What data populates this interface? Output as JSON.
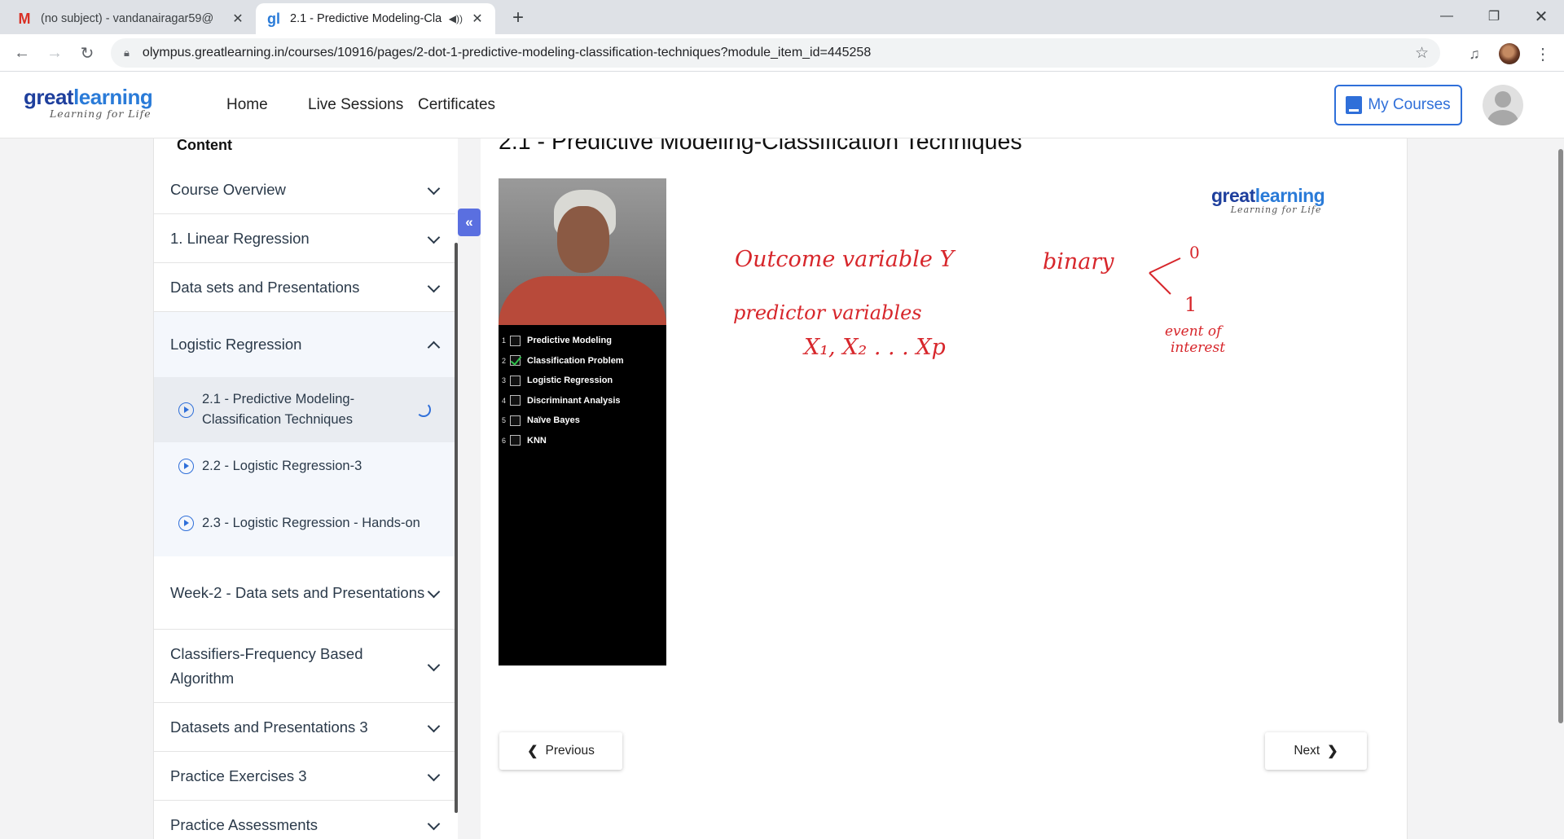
{
  "browser": {
    "tabs": [
      {
        "title": "(no subject) - vandanairagar59@",
        "favicon": "M",
        "favicon_color": "#d93025"
      },
      {
        "title": "2.1 - Predictive Modeling-Cla",
        "favicon": "gl",
        "favicon_color": "#2a7bd8"
      }
    ],
    "new_tab": "+",
    "window": {
      "minimize": "—",
      "restore": "❐",
      "close": "✕"
    },
    "url": "olympus.greatlearning.in/courses/10916/pages/2-dot-1-predictive-modeling-classification-techniques?module_item_id=445258"
  },
  "header": {
    "logo_great": "great",
    "logo_learning": "learning",
    "logo_tagline": "Learning for Life",
    "nav": [
      "Home",
      "Live Sessions",
      "Certificates"
    ],
    "my_courses": "My Courses"
  },
  "sidebar": {
    "title": "Content",
    "collapse_icon": "«",
    "modules": [
      {
        "label": "Course Overview",
        "state": "collapsed"
      },
      {
        "label": "1. Linear Regression",
        "state": "collapsed"
      },
      {
        "label": "Data sets and Presentations",
        "state": "collapsed"
      },
      {
        "label": "Logistic Regression",
        "state": "expanded"
      },
      {
        "label": "Week-2 - Data sets and Presentations",
        "state": "collapsed"
      },
      {
        "label": "Classifiers-Frequency Based Algorithm",
        "state": "collapsed"
      },
      {
        "label": "Datasets and Presentations 3",
        "state": "collapsed"
      },
      {
        "label": "Practice Exercises 3",
        "state": "collapsed"
      },
      {
        "label": "Practice Assessments",
        "state": "collapsed"
      }
    ],
    "items": [
      {
        "label": "2.1 - Predictive Modeling-Classification Techniques",
        "current": true
      },
      {
        "label": "2.2 - Logistic Regression-3",
        "current": false
      },
      {
        "label": "2.3 - Logistic Regression - Hands-on",
        "current": false
      }
    ]
  },
  "main": {
    "title": "2.1 - Predictive Modeling-Classification Techniques",
    "video": {
      "toc": [
        {
          "num": "1",
          "label": "Predictive Modeling",
          "checked": false
        },
        {
          "num": "2",
          "label": "Classification Problem",
          "checked": true
        },
        {
          "num": "3",
          "label": "Logistic Regression",
          "checked": false
        },
        {
          "num": "4",
          "label": "Discriminant Analysis",
          "checked": false
        },
        {
          "num": "5",
          "label": "Naïve Bayes",
          "checked": false
        },
        {
          "num": "6",
          "label": "KNN",
          "checked": false
        }
      ],
      "logo_great": "great",
      "logo_learning": "learning",
      "logo_tagline": "Learning for Life",
      "handwriting": {
        "outcome": "Outcome variable Y",
        "binary": "binary",
        "zero": "0",
        "one": "1",
        "event": "event of",
        "interest": "interest",
        "predictor": "predictor variables",
        "xs": "X₁, X₂ . . . Xp"
      }
    },
    "previous": "Previous",
    "next": "Next"
  },
  "colors": {
    "accent": "#2f6fd9",
    "brand_dark": "#1e3f9d",
    "ink": "#d7262b",
    "collapse": "#5a6fe0"
  }
}
